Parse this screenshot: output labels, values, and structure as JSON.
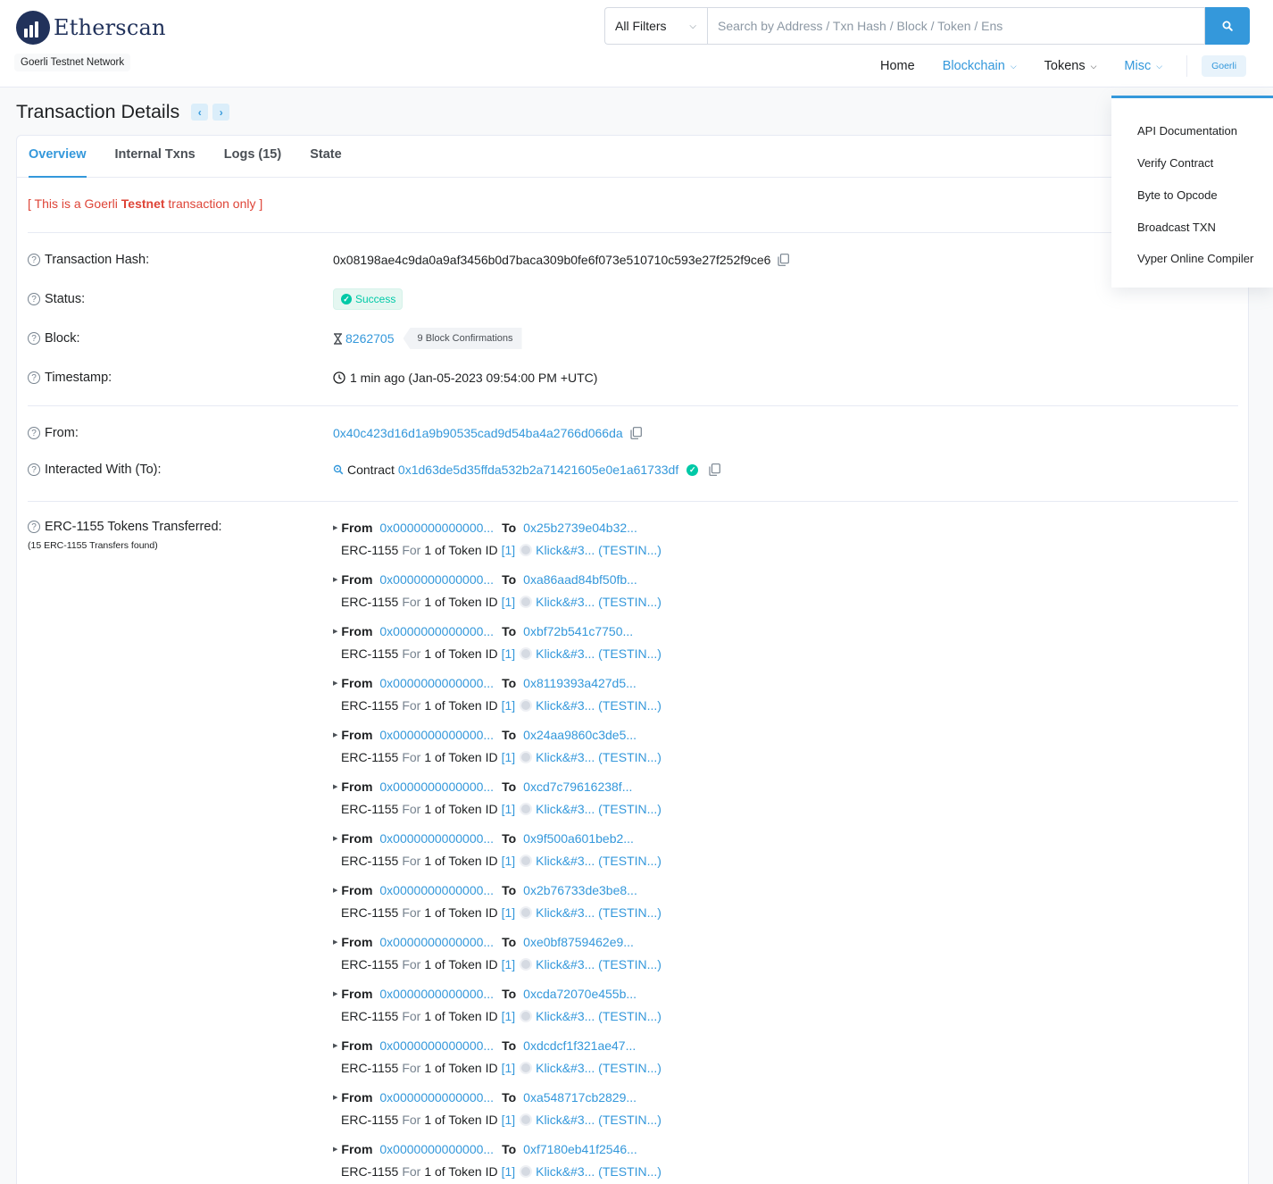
{
  "header": {
    "brand": "Etherscan",
    "network": "Goerli Testnet Network",
    "search": {
      "filter_label": "All Filters",
      "placeholder": "Search by Address / Txn Hash / Block / Token / Ens"
    },
    "nav": {
      "home": "Home",
      "blockchain": "Blockchain",
      "tokens": "Tokens",
      "misc": "Misc",
      "network_button": "Goerli"
    }
  },
  "page": {
    "title": "Transaction Details",
    "prev": "‹",
    "next": "›"
  },
  "tabs": {
    "overview": "Overview",
    "internal": "Internal Txns",
    "logs": "Logs (15)",
    "state": "State"
  },
  "note": {
    "prefix": "[ This is a Goerli ",
    "bold": "Testnet",
    "suffix": " transaction only ]"
  },
  "fields": {
    "hash_label": "Transaction Hash:",
    "hash": "0x08198ae4c9da0a9af3456b0d7baca309b0fe6f073e510710c593e27f252f9ce6",
    "status_label": "Status:",
    "status": "Success",
    "block_label": "Block:",
    "block": "8262705",
    "confirmations": "9 Block Confirmations",
    "timestamp_label": "Timestamp:",
    "timestamp": "1 min ago (Jan-05-2023 09:54:00 PM +UTC)",
    "from_label": "From:",
    "from": "0x40c423d16d1a9b90535cad9d54ba4a2766d066da",
    "to_label": "Interacted With (To):",
    "contract_word": "Contract",
    "to": "0x1d63de5d35ffda532b2a71421605e0e1a61733df",
    "erc_label": "ERC-1155 Tokens Transferred:",
    "erc_sub": "(15 ERC-1155 Transfers found)"
  },
  "transfer_common": {
    "from_word": "From",
    "to_word": "To",
    "from_addr": "0x0000000000000...",
    "standard": "ERC-1155",
    "for_word": "For",
    "of_text": "1 of Token ID",
    "token_id": "[1]",
    "token_name": "Klick&#3... (TESTIN...)"
  },
  "transfers": [
    {
      "to": "0x25b2739e04b32..."
    },
    {
      "to": "0xa86aad84bf50fb..."
    },
    {
      "to": "0xbf72b541c7750..."
    },
    {
      "to": "0x8119393a427d5..."
    },
    {
      "to": "0x24aa9860c3de5..."
    },
    {
      "to": "0xcd7c79616238f..."
    },
    {
      "to": "0x9f500a601beb2..."
    },
    {
      "to": "0x2b76733de3be8..."
    },
    {
      "to": "0xe0bf8759462e9..."
    },
    {
      "to": "0xcda72070e455b..."
    },
    {
      "to": "0xdcdcf1f321ae47..."
    },
    {
      "to": "0xa548717cb2829..."
    },
    {
      "to": "0xf7180eb41f2546..."
    }
  ],
  "misc_menu": {
    "items": [
      "API Documentation",
      "Verify Contract",
      "Byte to Opcode",
      "Broadcast TXN",
      "Vyper Online Compiler"
    ]
  }
}
